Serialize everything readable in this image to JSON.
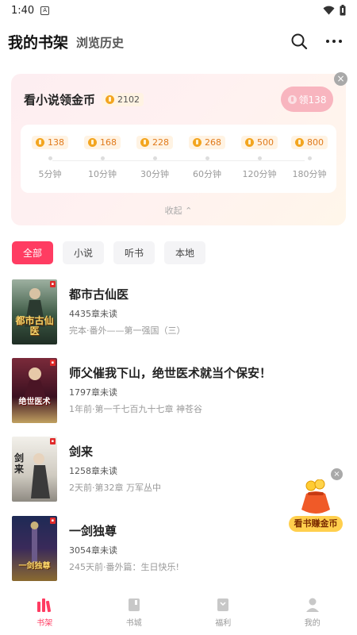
{
  "status_bar": {
    "time": "1:40",
    "notification_glyph": "A"
  },
  "header": {
    "title": "我的书架",
    "history_label": "浏览历史",
    "icons": [
      "search-icon",
      "more-icon"
    ]
  },
  "coin_task": {
    "title": "看小说领金币",
    "balance": "2102",
    "claim_label": "领138",
    "close_glyph": "×",
    "tiers": [
      {
        "coins": "138",
        "label": "5分钟"
      },
      {
        "coins": "168",
        "label": "10分钟"
      },
      {
        "coins": "228",
        "label": "30分钟"
      },
      {
        "coins": "268",
        "label": "60分钟"
      },
      {
        "coins": "500",
        "label": "120分钟"
      },
      {
        "coins": "800",
        "label": "180分钟"
      }
    ],
    "collapse_label": "收起 ⌃"
  },
  "filters": [
    {
      "label": "全部",
      "active": true
    },
    {
      "label": "小说",
      "active": false
    },
    {
      "label": "听书",
      "active": false
    },
    {
      "label": "本地",
      "active": false
    }
  ],
  "books": [
    {
      "title": "都市古仙医",
      "unread": "4435章未读",
      "latest": "完本·番外——第一强国（三）",
      "cover_text": "都市古仙医"
    },
    {
      "title": "师父催我下山，绝世医术就当个保安！",
      "unread": "1797章未读",
      "latest": "1年前·第一千七百九十七章 神苍谷",
      "cover_text": "绝世医术"
    },
    {
      "title": "剑来",
      "unread": "1258章未读",
      "latest": "2天前·第32章 万军丛中",
      "cover_text": "剑来"
    },
    {
      "title": "一剑独尊",
      "unread": "3054章未读",
      "latest": "245天前·番外篇：生日快乐!",
      "cover_text": "一剑独尊"
    }
  ],
  "promo": {
    "label": "看书赚金币",
    "close_glyph": "×"
  },
  "nav": [
    {
      "label": "书架",
      "icon": "bookshelf-icon",
      "active": true
    },
    {
      "label": "书城",
      "icon": "bookstore-icon",
      "active": false
    },
    {
      "label": "福利",
      "icon": "gift-icon",
      "active": false
    },
    {
      "label": "我的",
      "icon": "profile-icon",
      "active": false
    }
  ],
  "colors": {
    "accent": "#ff3c62",
    "coin": "#f3a51f",
    "promo": "#ffcf4d"
  }
}
